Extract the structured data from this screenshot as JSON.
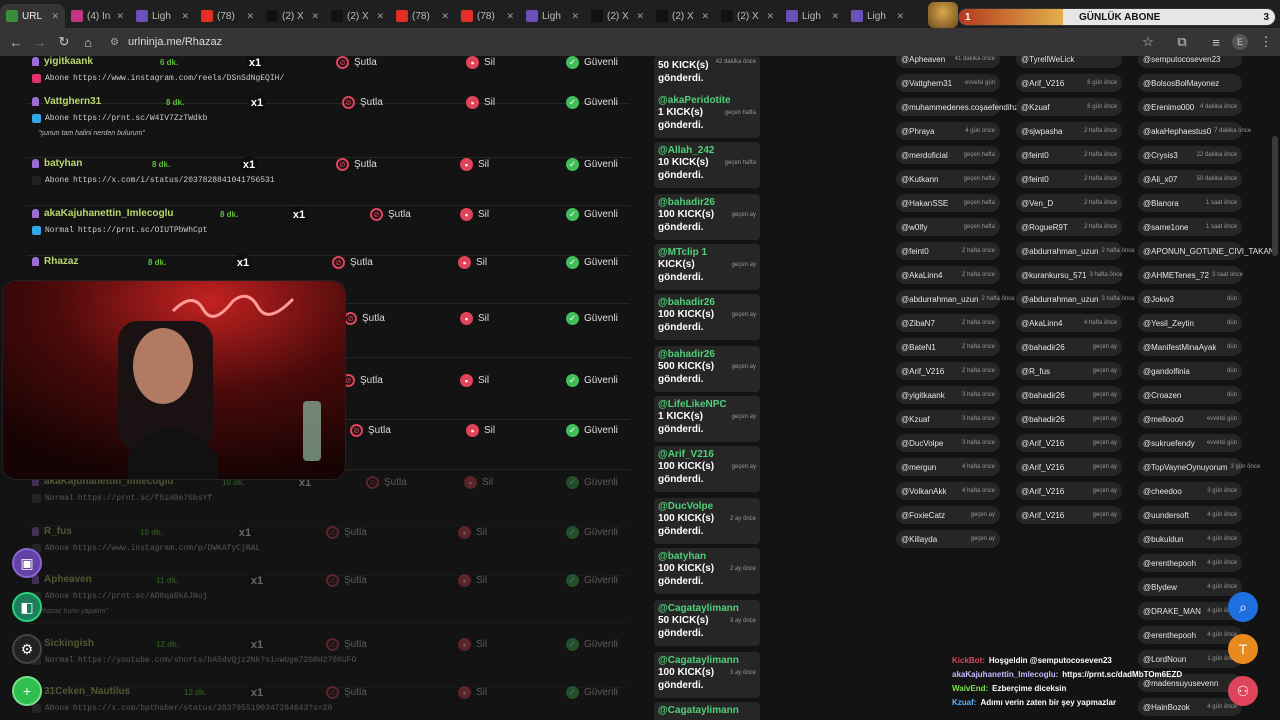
{
  "browser": {
    "tabs": [
      {
        "label": "URL",
        "fav": "#3a8f3a",
        "active": true
      },
      {
        "label": "(4) In",
        "fav": "#c13584"
      },
      {
        "label": "Ligh",
        "fav": "#6b4fbb"
      },
      {
        "label": "(78)",
        "fav": "#e52d27"
      },
      {
        "label": "(2) X",
        "fav": "#111"
      },
      {
        "label": "(2) X",
        "fav": "#111"
      },
      {
        "label": "(78)",
        "fav": "#e52d27"
      },
      {
        "label": "(78)",
        "fav": "#e52d27"
      },
      {
        "label": "Ligh",
        "fav": "#6b4fbb"
      },
      {
        "label": "(2) X",
        "fav": "#111"
      },
      {
        "label": "(2) X",
        "fav": "#111"
      },
      {
        "label": "(2) X",
        "fav": "#111"
      },
      {
        "label": "Ligh",
        "fav": "#6b4fbb"
      },
      {
        "label": "Ligh",
        "fav": "#6b4fbb"
      }
    ],
    "url": "urlninja.me/Rhazaz"
  },
  "overlay": {
    "goal_title": "GÜNLÜK ABONE",
    "goal_left": "1",
    "goal_right": "3",
    "goal_fraction": 0.33
  },
  "actions": {
    "ban": "Şutla",
    "delete": "Sil",
    "trust": "Güvenli",
    "count": "x1"
  },
  "rows": [
    {
      "user": "yigitkaank",
      "ago": "6 dk.",
      "type": "Abone",
      "url": "https://www.instagram.com/reels/DSnSdNgEQIH/",
      "icon": "instagram",
      "quote": ""
    },
    {
      "user": "Vattghern31",
      "ago": "8 dk.",
      "type": "Abone",
      "url": "https://prnt.sc/W4IV7ZzTWdkb",
      "icon": "prnt",
      "quote": "\"şunun tam halini nerden bulurum\""
    },
    {
      "user": "batyhan",
      "ago": "8 dk.",
      "type": "Abone",
      "url": "https://x.com/i/status/2037828841041756531",
      "icon": "x",
      "quote": ""
    },
    {
      "user": "akaKajuhanettin_Imlecoglu",
      "ago": "8 dk.",
      "type": "Normal",
      "url": "https://prnt.sc/OIUTPbWhCpt",
      "icon": "prnt",
      "quote": ""
    },
    {
      "user": "Rhazaz",
      "ago": "8 dk.",
      "type": "",
      "url": "",
      "icon": "",
      "quote": ""
    }
  ],
  "faded_rows": [
    {
      "user": "akaKajuhanettin_Imlecoglu",
      "ago": "10 dk.",
      "type": "Normal",
      "url": "https://prnt.sc/f5iH0e76bsYf",
      "quote": ""
    },
    {
      "user": "R_fus",
      "ago": "10 dk.",
      "type": "Abone",
      "url": "https://www.instagram.com/p/DWKAfyCjRAL",
      "quote": ""
    },
    {
      "user": "Apheaven",
      "ago": "11 dk.",
      "type": "Abone",
      "url": "https://prnt.sc/AD0qaBkAJNuj",
      "quote": "\"rhazaz bunu yapalım\""
    },
    {
      "user": "Sickingish",
      "ago": "12 dk.",
      "type": "Normal",
      "url": "https://youtube.com/shorts/bA5dvQjz2Nk?si=wUge72G0H270XUFO",
      "quote": ""
    },
    {
      "user": "31Ceken_Nautilus",
      "ago": "12 dk.",
      "type": "Abone",
      "url": "https://x.com/bpthaber/status/2037955190347284643?s=20",
      "quote": ""
    }
  ],
  "kicks": [
    {
      "name": "",
      "text": "50 KICK(s) gönderdi.",
      "time": "42 dakika önce"
    },
    {
      "name": "@akaPeridotite",
      "text": "1 KICK(s) gönderdi.",
      "time": "geçen hafta"
    },
    {
      "name": "@Allah_242",
      "text": "10 KICK(s) gönderdi.",
      "time": "geçen hafta"
    },
    {
      "name": "@bahadir26",
      "text": "100 KICK(s) gönderdi.",
      "time": "geçen ay"
    },
    {
      "name": "@MTclip 1",
      "text": "KICK(s) gönderdi.",
      "time": "geçen ay"
    },
    {
      "name": "@bahadir26",
      "text": "100 KICK(s) gönderdi.",
      "time": "geçen ay"
    },
    {
      "name": "@bahadir26",
      "text": "500 KICK(s) gönderdi.",
      "time": "geçen ay"
    },
    {
      "name": "@LifeLikeNPC",
      "text": "1 KICK(s) gönderdi.",
      "time": "geçen ay"
    },
    {
      "name": "@Arif_V216",
      "text": "100 KICK(s) gönderdi.",
      "time": "geçen ay"
    },
    {
      "name": "@DucVolpe",
      "text": "100 KICK(s) gönderdi.",
      "time": "2 ay önce"
    },
    {
      "name": "@batyhan",
      "text": "100 KICK(s) gönderdi.",
      "time": "2 ay önce"
    },
    {
      "name": "@Cagataylimann",
      "text": "50 KICK(s) gönderdi.",
      "time": "3 ay önce"
    },
    {
      "name": "@Cagataylimann",
      "text": "100 KICK(s) gönderdi.",
      "time": "3 ay önce"
    },
    {
      "name": "@Cagataylimann",
      "text": "",
      "time": ""
    }
  ],
  "subs_col1": [
    [
      "@Apheaven",
      "41 dakika önce"
    ],
    [
      "@Vattghern31",
      "evvelsi gün"
    ],
    [
      "@muhammedenes.coşaefendihz",
      ""
    ],
    [
      "@Phraya",
      "4 gün önce"
    ],
    [
      "@merdoficial",
      "geçen hafta"
    ],
    [
      "@Kutkann",
      "geçen hafta"
    ],
    [
      "@HakanSSE",
      "geçen hafta"
    ],
    [
      "@w0lfy",
      "geçen hafta"
    ],
    [
      "@feint0",
      "2 hafta önce"
    ],
    [
      "@AkaLinn4",
      "2 hafta önce"
    ],
    [
      "@abdurrahman_uzun",
      "2 hafta önce"
    ],
    [
      "@ZibaN7",
      "2 hafta önce"
    ],
    [
      "@BateN1",
      "2 hafta önce"
    ],
    [
      "@Arif_V216",
      "2 hafta önce"
    ],
    [
      "@yigitkaank",
      "3 hafta önce"
    ],
    [
      "@Kzuaf",
      "3 hafta önce"
    ],
    [
      "@DucVolpe",
      "3 hafta önce"
    ],
    [
      "@mergun",
      "4 hafta önce"
    ],
    [
      "@VolkanAkk",
      "4 hafta önce"
    ],
    [
      "@FoxieCatz",
      "geçen ay"
    ],
    [
      "@Killayda",
      "geçen ay"
    ]
  ],
  "subs_col2": [
    [
      "@TyrellWeLick",
      ""
    ],
    [
      "@Arif_V216",
      "6 gün önce"
    ],
    [
      "@Kzuaf",
      "6 gün önce"
    ],
    [
      "@sjwpasha",
      "2 hafta önce"
    ],
    [
      "@feint0",
      "2 hafta önce"
    ],
    [
      "@feint0",
      "2 hafta önce"
    ],
    [
      "@Ven_D",
      "2 hafta önce"
    ],
    [
      "@RogueR9T",
      "2 hafta önce"
    ],
    [
      "@abdurrahman_uzun",
      "2 hafta önce"
    ],
    [
      "@kurankursu_571",
      "3 hafta önce"
    ],
    [
      "@abdurrahman_uzun",
      "3 hafta önce"
    ],
    [
      "@AkaLinn4",
      "4 hafta önce"
    ],
    [
      "@bahadir26",
      "geçen ay"
    ],
    [
      "@R_fus",
      "geçen ay"
    ],
    [
      "@bahadir26",
      "geçen ay"
    ],
    [
      "@bahadir26",
      "geçen ay"
    ],
    [
      "@Arif_V216",
      "geçen ay"
    ],
    [
      "@Arif_V216",
      "geçen ay"
    ],
    [
      "@Arif_V216",
      "geçen ay"
    ],
    [
      "@Arif_V216",
      "geçen ay"
    ]
  ],
  "subs_col3": [
    [
      "@semputocoseven23",
      ""
    ],
    [
      "@BolsosBolMayonez",
      ""
    ],
    [
      "@Erenimo000",
      "4 dakika önce"
    ],
    [
      "@akaHephaestus0",
      "7 dakika önce"
    ],
    [
      "@Crysis3",
      "22 dakika önce"
    ],
    [
      "@Ali_x07",
      "50 dakika önce"
    ],
    [
      "@Blanora",
      "1 saat önce"
    ],
    [
      "@same1one",
      "1 saat önce"
    ],
    [
      "@APONUN_GOTUNE_CIVI_TAKAN",
      ""
    ],
    [
      "@AHMETenes_72",
      "3 saat önce"
    ],
    [
      "@Jokw3",
      "dün"
    ],
    [
      "@Yesil_Zeytin",
      "dün"
    ],
    [
      "@ManifestMinaAyak",
      "dün"
    ],
    [
      "@gandolfinia",
      "dün"
    ],
    [
      "@Croazen",
      "dün"
    ],
    [
      "@mellooo0",
      "evvelsi gün"
    ],
    [
      "@sukruefendy",
      "evvelsi gün"
    ],
    [
      "@TopVayneOynuyorum",
      "3 gün önce"
    ],
    [
      "@cheedoo",
      "3 gün önce"
    ],
    [
      "@uundersoft",
      "4 gün önce"
    ],
    [
      "@bukuldun",
      "4 gün önce"
    ],
    [
      "@erenthepooh",
      "4 gün önce"
    ],
    [
      "@Blydew",
      "4 gün önce"
    ],
    [
      "@DRAKE_MAN",
      "4 gün önce"
    ],
    [
      "@erenthepooh",
      "4 gün önce"
    ],
    [
      "@LordNoun",
      "1 gün önce"
    ],
    [
      "@madensuyusevenn",
      ""
    ],
    [
      "@HainBozok",
      "4 gün önce"
    ]
  ],
  "chat": [
    {
      "user": "KickBot:",
      "user_color": "#e0445a",
      "text": "Hoşgeldin @semputocoseven23"
    },
    {
      "user": "akaKajuhanettin_Imlecoglu:",
      "user_color": "#c9b6ff",
      "text": "https://prnt.sc/dadMbTOm6EZD"
    },
    {
      "user": "WaivEnd:",
      "user_color": "#7ee04f",
      "text": "Ezberçime diceksin"
    },
    {
      "user": "Kzuaf:",
      "user_color": "#5fb4ff",
      "text": "Adımı verin zaten bir şey yapmazlar"
    }
  ]
}
